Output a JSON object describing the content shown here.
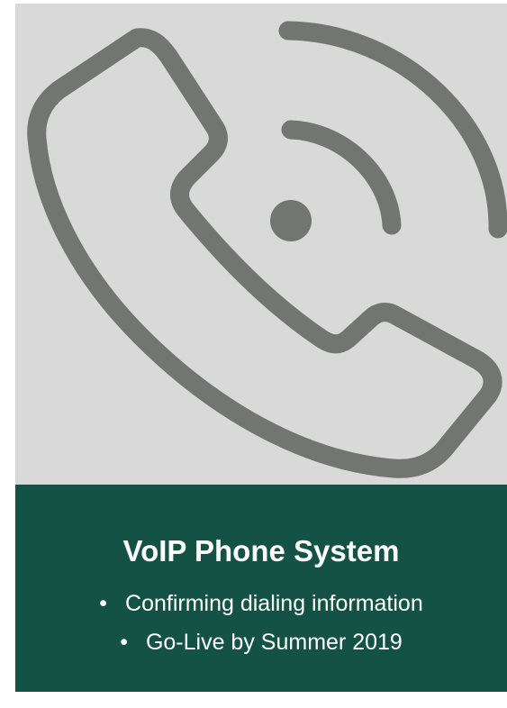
{
  "colors": {
    "icon_panel_bg": "#d9d9d9",
    "icon_stroke": "#737572",
    "info_panel_bg": "#135245",
    "text": "#ffffff"
  },
  "icon": "phone-call-icon",
  "title": "VoIP Phone System",
  "bullets": [
    {
      "marker": "•",
      "text": "Confirming dialing information"
    },
    {
      "marker": "•",
      "text": "Go-Live by Summer 2019"
    }
  ]
}
